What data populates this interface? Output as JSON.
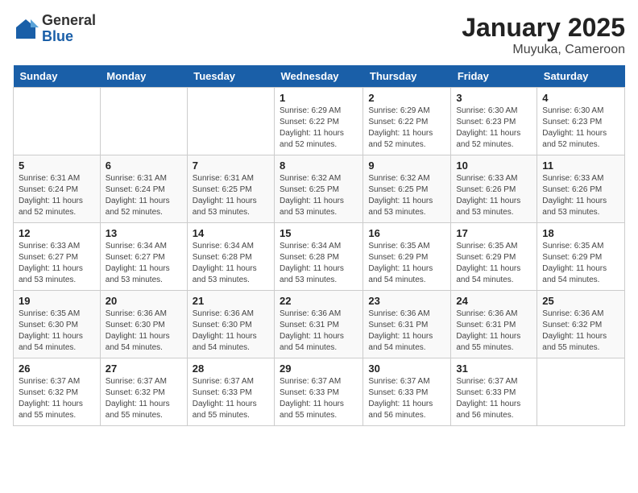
{
  "logo": {
    "general": "General",
    "blue": "Blue"
  },
  "title": "January 2025",
  "subtitle": "Muyuka, Cameroon",
  "days_header": [
    "Sunday",
    "Monday",
    "Tuesday",
    "Wednesday",
    "Thursday",
    "Friday",
    "Saturday"
  ],
  "weeks": [
    [
      {
        "day": "",
        "info": ""
      },
      {
        "day": "",
        "info": ""
      },
      {
        "day": "",
        "info": ""
      },
      {
        "day": "1",
        "info": "Sunrise: 6:29 AM\nSunset: 6:22 PM\nDaylight: 11 hours\nand 52 minutes."
      },
      {
        "day": "2",
        "info": "Sunrise: 6:29 AM\nSunset: 6:22 PM\nDaylight: 11 hours\nand 52 minutes."
      },
      {
        "day": "3",
        "info": "Sunrise: 6:30 AM\nSunset: 6:23 PM\nDaylight: 11 hours\nand 52 minutes."
      },
      {
        "day": "4",
        "info": "Sunrise: 6:30 AM\nSunset: 6:23 PM\nDaylight: 11 hours\nand 52 minutes."
      }
    ],
    [
      {
        "day": "5",
        "info": "Sunrise: 6:31 AM\nSunset: 6:24 PM\nDaylight: 11 hours\nand 52 minutes."
      },
      {
        "day": "6",
        "info": "Sunrise: 6:31 AM\nSunset: 6:24 PM\nDaylight: 11 hours\nand 52 minutes."
      },
      {
        "day": "7",
        "info": "Sunrise: 6:31 AM\nSunset: 6:25 PM\nDaylight: 11 hours\nand 53 minutes."
      },
      {
        "day": "8",
        "info": "Sunrise: 6:32 AM\nSunset: 6:25 PM\nDaylight: 11 hours\nand 53 minutes."
      },
      {
        "day": "9",
        "info": "Sunrise: 6:32 AM\nSunset: 6:25 PM\nDaylight: 11 hours\nand 53 minutes."
      },
      {
        "day": "10",
        "info": "Sunrise: 6:33 AM\nSunset: 6:26 PM\nDaylight: 11 hours\nand 53 minutes."
      },
      {
        "day": "11",
        "info": "Sunrise: 6:33 AM\nSunset: 6:26 PM\nDaylight: 11 hours\nand 53 minutes."
      }
    ],
    [
      {
        "day": "12",
        "info": "Sunrise: 6:33 AM\nSunset: 6:27 PM\nDaylight: 11 hours\nand 53 minutes."
      },
      {
        "day": "13",
        "info": "Sunrise: 6:34 AM\nSunset: 6:27 PM\nDaylight: 11 hours\nand 53 minutes."
      },
      {
        "day": "14",
        "info": "Sunrise: 6:34 AM\nSunset: 6:28 PM\nDaylight: 11 hours\nand 53 minutes."
      },
      {
        "day": "15",
        "info": "Sunrise: 6:34 AM\nSunset: 6:28 PM\nDaylight: 11 hours\nand 53 minutes."
      },
      {
        "day": "16",
        "info": "Sunrise: 6:35 AM\nSunset: 6:29 PM\nDaylight: 11 hours\nand 54 minutes."
      },
      {
        "day": "17",
        "info": "Sunrise: 6:35 AM\nSunset: 6:29 PM\nDaylight: 11 hours\nand 54 minutes."
      },
      {
        "day": "18",
        "info": "Sunrise: 6:35 AM\nSunset: 6:29 PM\nDaylight: 11 hours\nand 54 minutes."
      }
    ],
    [
      {
        "day": "19",
        "info": "Sunrise: 6:35 AM\nSunset: 6:30 PM\nDaylight: 11 hours\nand 54 minutes."
      },
      {
        "day": "20",
        "info": "Sunrise: 6:36 AM\nSunset: 6:30 PM\nDaylight: 11 hours\nand 54 minutes."
      },
      {
        "day": "21",
        "info": "Sunrise: 6:36 AM\nSunset: 6:30 PM\nDaylight: 11 hours\nand 54 minutes."
      },
      {
        "day": "22",
        "info": "Sunrise: 6:36 AM\nSunset: 6:31 PM\nDaylight: 11 hours\nand 54 minutes."
      },
      {
        "day": "23",
        "info": "Sunrise: 6:36 AM\nSunset: 6:31 PM\nDaylight: 11 hours\nand 54 minutes."
      },
      {
        "day": "24",
        "info": "Sunrise: 6:36 AM\nSunset: 6:31 PM\nDaylight: 11 hours\nand 55 minutes."
      },
      {
        "day": "25",
        "info": "Sunrise: 6:36 AM\nSunset: 6:32 PM\nDaylight: 11 hours\nand 55 minutes."
      }
    ],
    [
      {
        "day": "26",
        "info": "Sunrise: 6:37 AM\nSunset: 6:32 PM\nDaylight: 11 hours\nand 55 minutes."
      },
      {
        "day": "27",
        "info": "Sunrise: 6:37 AM\nSunset: 6:32 PM\nDaylight: 11 hours\nand 55 minutes."
      },
      {
        "day": "28",
        "info": "Sunrise: 6:37 AM\nSunset: 6:33 PM\nDaylight: 11 hours\nand 55 minutes."
      },
      {
        "day": "29",
        "info": "Sunrise: 6:37 AM\nSunset: 6:33 PM\nDaylight: 11 hours\nand 55 minutes."
      },
      {
        "day": "30",
        "info": "Sunrise: 6:37 AM\nSunset: 6:33 PM\nDaylight: 11 hours\nand 56 minutes."
      },
      {
        "day": "31",
        "info": "Sunrise: 6:37 AM\nSunset: 6:33 PM\nDaylight: 11 hours\nand 56 minutes."
      },
      {
        "day": "",
        "info": ""
      }
    ]
  ]
}
